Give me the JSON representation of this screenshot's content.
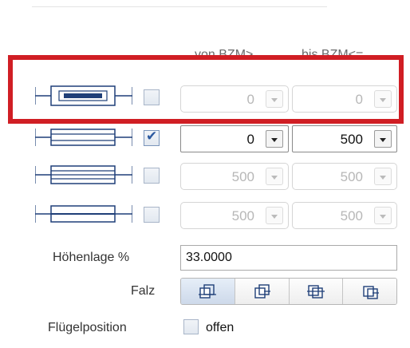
{
  "columns": {
    "von_label": "von BZM>",
    "bis_label": "bis BZM<="
  },
  "rows": [
    {
      "checked": false,
      "von": "0",
      "bis": "0",
      "enabled": false,
      "icon": "profile-double-bar-icon"
    },
    {
      "checked": true,
      "von": "0",
      "bis": "500",
      "enabled": true,
      "icon": "profile-frame-icon"
    },
    {
      "checked": false,
      "von": "500",
      "bis": "500",
      "enabled": false,
      "icon": "profile-triple-line-icon"
    },
    {
      "checked": false,
      "von": "500",
      "bis": "500",
      "enabled": false,
      "icon": "profile-single-line-icon"
    }
  ],
  "hoehenlage": {
    "label": "Höhenlage %",
    "value": "33.0000"
  },
  "falz": {
    "label": "Falz",
    "options": [
      "falz-option-1-icon",
      "falz-option-2-icon",
      "falz-option-3-icon",
      "falz-option-4-icon"
    ],
    "selected": 0
  },
  "fluegelposition": {
    "label": "Flügelposition",
    "checkbox_label": "offen",
    "checked": false
  },
  "colors": {
    "highlight": "#d01e24",
    "check": "#2c5aa0",
    "icon_stroke": "#1f3f78"
  }
}
